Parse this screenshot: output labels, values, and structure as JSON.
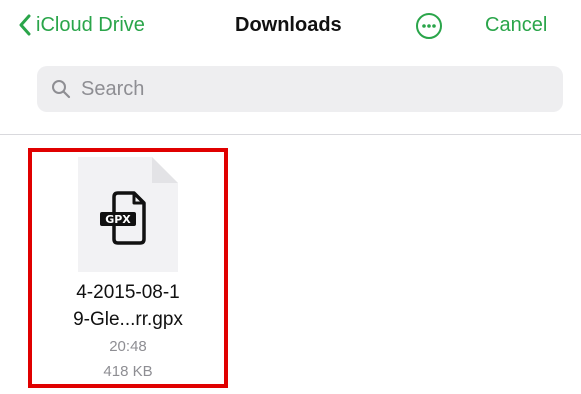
{
  "header": {
    "back_label": "iCloud Drive",
    "title": "Downloads",
    "cancel_label": "Cancel"
  },
  "search": {
    "placeholder": "Search"
  },
  "files": [
    {
      "name_line1": "4-2015-08-1",
      "name_line2": "9-Gle...rr.gpx",
      "time": "20:48",
      "size": "418 KB",
      "icon_label": "GPX",
      "highlighted": true
    }
  ],
  "colors": {
    "accent": "#2aa54a",
    "highlight": "#e00000",
    "secondary_text": "#8e8e93"
  },
  "icons": {
    "back": "chevron-left-icon",
    "more": "ellipsis-circle-icon",
    "search": "search-icon",
    "file": "gpx-file-icon"
  }
}
